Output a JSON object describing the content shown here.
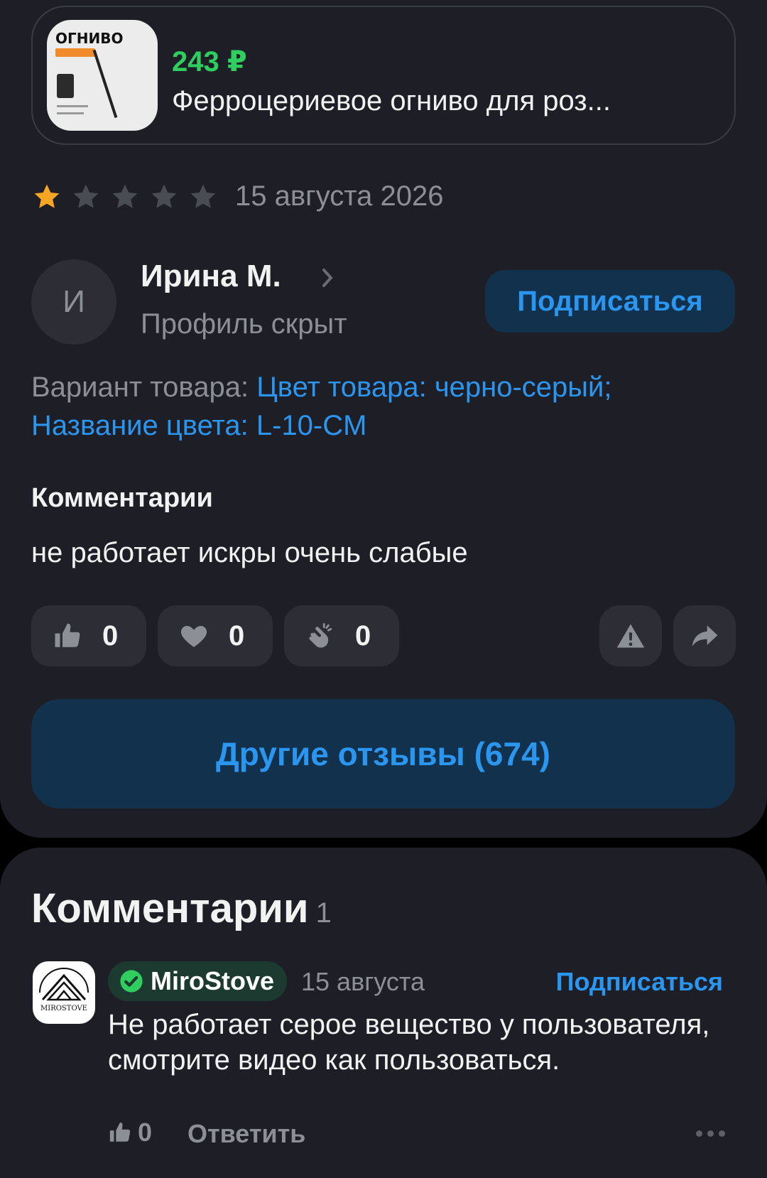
{
  "product": {
    "thumb_title": "ОГНИВО",
    "price": "243 ₽",
    "name": "Ферроцериевое огниво для роз..."
  },
  "review": {
    "rating": 1,
    "rating_max": 5,
    "date": "15 августа 2026",
    "author": {
      "initial": "И",
      "name": "Ирина М.",
      "subtitle": "Профиль скрыт"
    },
    "subscribe_label": "Подписаться",
    "variant": {
      "label": "Вариант товара:",
      "value": "Цвет товара: черно-серый; Название цвета: L-10-CM"
    },
    "comments_heading": "Комментарии",
    "comment": "не работает искры очень слабые",
    "reactions": {
      "likes": "0",
      "hearts": "0",
      "claps": "0"
    }
  },
  "other_reviews_label": "Другие отзывы (674)",
  "comments_section": {
    "title": "Комментарии",
    "count": "1",
    "items": [
      {
        "author": "MiroStove",
        "verified": true,
        "date": "15 августа",
        "subscribe_label": "Подписаться",
        "text": "Не работает серое вещество у пользователя, смотрите видео как пользоваться.",
        "likes": "0",
        "reply_label": "Ответить"
      }
    ]
  },
  "colors": {
    "background": "#000000",
    "card": "#1e1f26",
    "accent_blue": "#2a96f0",
    "price_green": "#2fcf5f",
    "star_active": "#f5a623",
    "star_inactive": "#4a4c53"
  }
}
